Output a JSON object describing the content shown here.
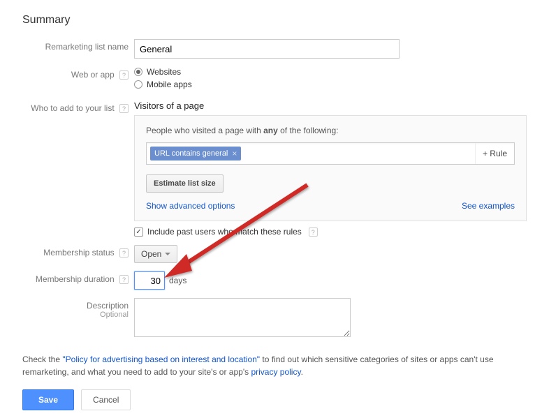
{
  "title": "Summary",
  "labels": {
    "remarketing_list_name": "Remarketing list name",
    "web_or_app": "Web or app",
    "who_to_add": "Who to add to your list",
    "membership_status": "Membership status",
    "membership_duration": "Membership duration",
    "description": "Description",
    "optional": "Optional"
  },
  "list_name_value": "General",
  "web_or_app_options": {
    "websites": "Websites",
    "mobile_apps": "Mobile apps",
    "selected": "websites"
  },
  "visitors": {
    "heading": "Visitors of a page",
    "rule_intro_prefix": "People who visited a page with ",
    "rule_intro_bold": "any",
    "rule_intro_suffix": " of the following:",
    "chip_text": "URL contains general",
    "add_rule": "+ Rule",
    "estimate_btn": "Estimate list size",
    "advanced_link": "Show advanced options",
    "examples_link": "See examples"
  },
  "include_past": "Include past users who match these rules",
  "membership_status": {
    "value": "Open"
  },
  "membership_duration": {
    "value": "30",
    "unit": "days"
  },
  "description_value": "",
  "footer": {
    "prefix": "Check the ",
    "policy_link": "\"Policy for advertising based on interest and location\"",
    "middle": " to find out which sensitive categories of sites or apps can't use remarketing, and what you need to add to your site's or app's ",
    "privacy_link": "privacy policy",
    "suffix": "."
  },
  "buttons": {
    "save": "Save",
    "cancel": "Cancel"
  }
}
